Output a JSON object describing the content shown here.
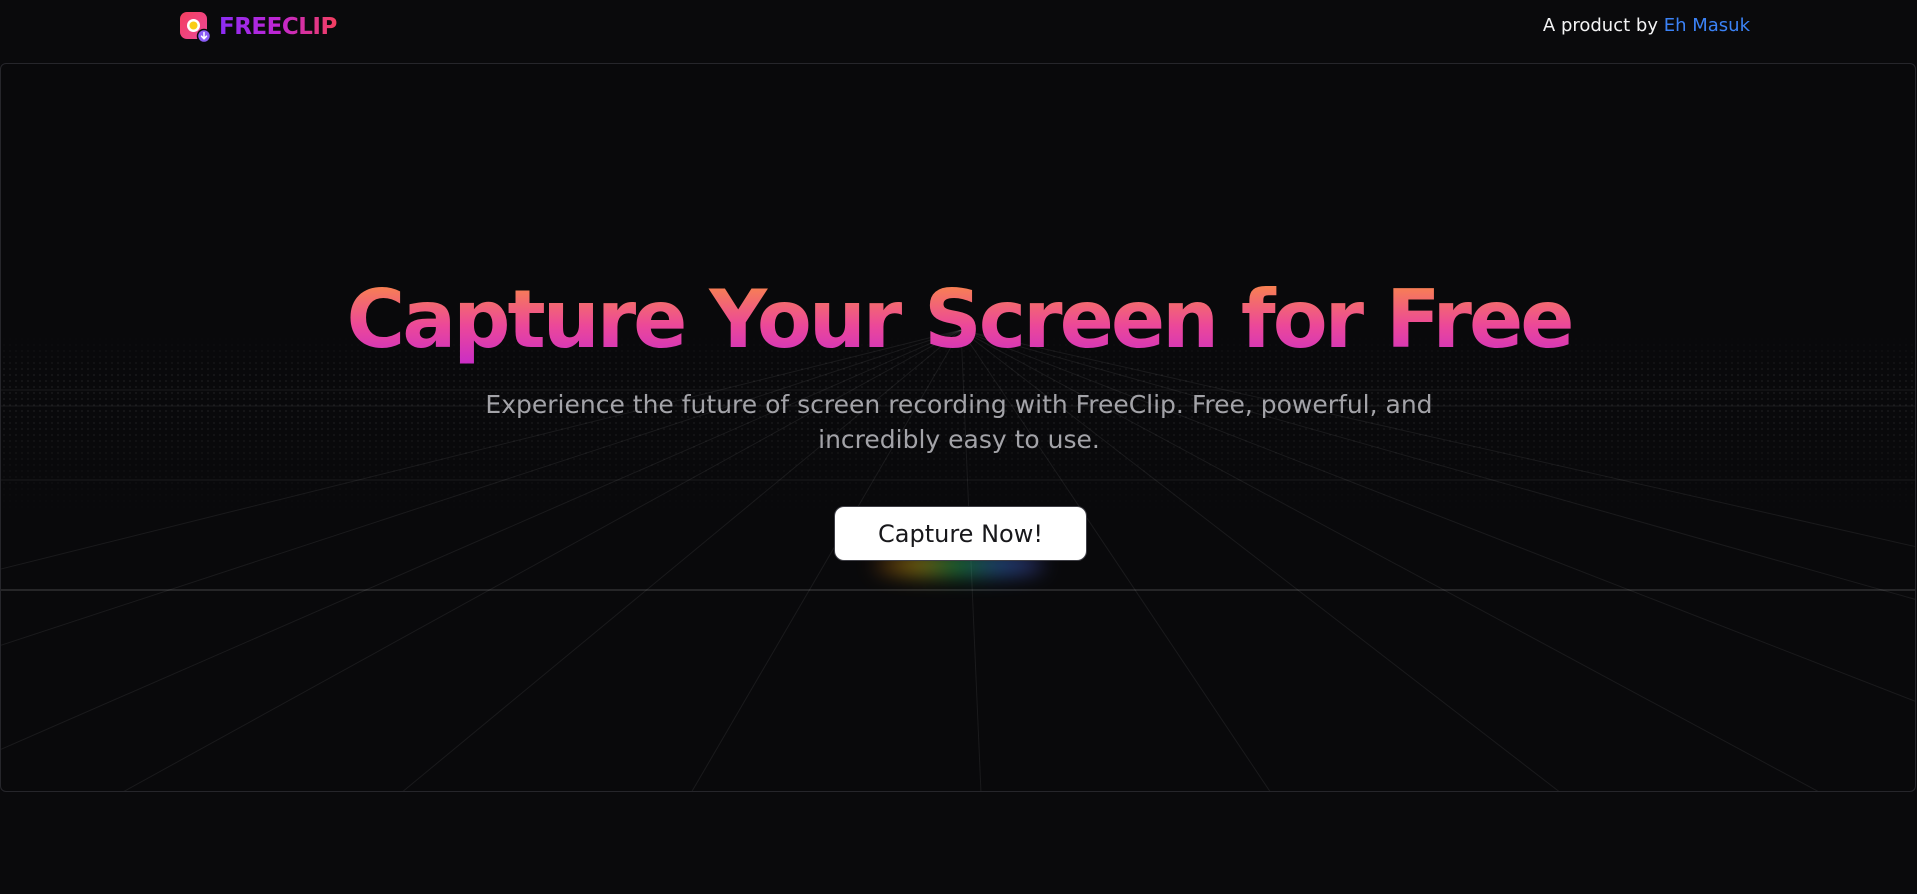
{
  "header": {
    "brand": "FREECLIP",
    "logo_icon": "record-download-icon",
    "byline_prefix": "A product by",
    "byline_author": "Eh Masuk"
  },
  "hero": {
    "headline": "Capture Your Screen for Free",
    "subtext": "Experience the future of screen recording with FreeClip. Free, powerful, and incredibly easy to use.",
    "cta_label": "Capture Now!"
  },
  "colors": {
    "background": "#0a0a0c",
    "brand_gradient": [
      "#8b2cf5",
      "#c026d3",
      "#f43f5e"
    ],
    "headline_gradient": [
      "#fb923c",
      "#ec4899",
      "#c026d3"
    ],
    "author_link": "#3b82f6",
    "cta_bg": "#ffffff"
  }
}
